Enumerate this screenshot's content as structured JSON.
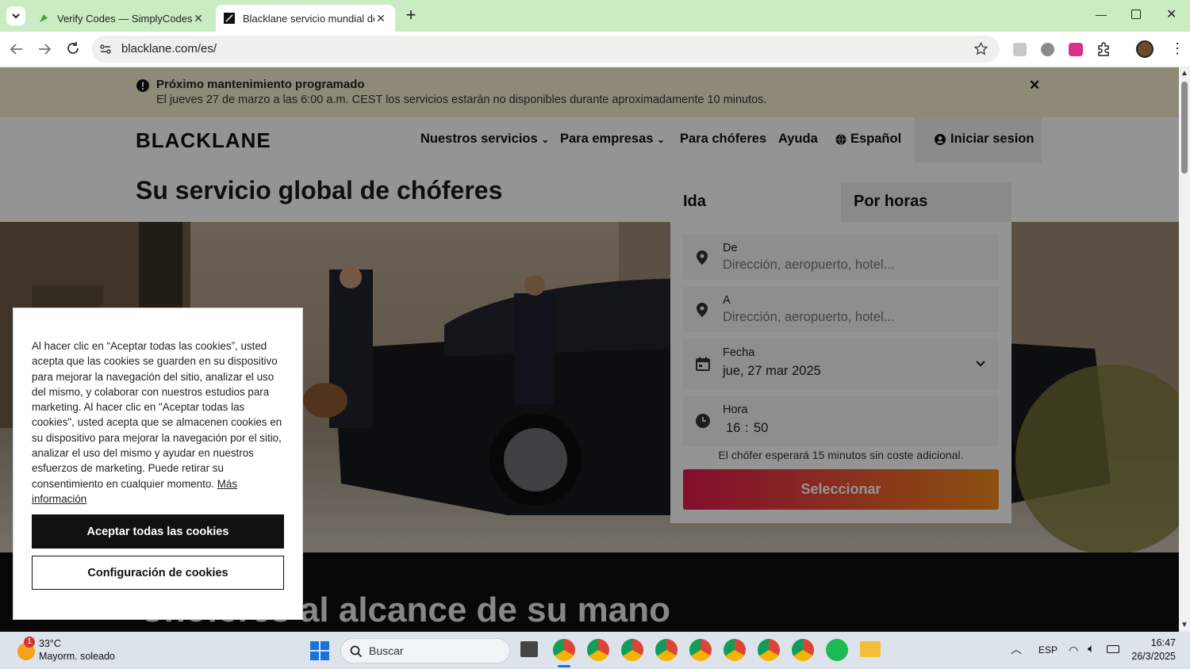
{
  "browser": {
    "tabs": [
      {
        "title": "Verify Codes — SimplyCodes",
        "active": false
      },
      {
        "title": "Blacklane servicio mundial de ch",
        "active": true
      }
    ],
    "url": "blacklane.com/es/"
  },
  "maintenance": {
    "title": "Próximo mantenimiento programado",
    "message": "El jueves 27 de marzo a las 6:00 a.m. CEST los servicios estarán no disponibles durante aproximadamente 10 minutos."
  },
  "nav": {
    "logo": "BLACKLANE",
    "services": "Nuestros servicios",
    "business": "Para empresas",
    "drivers": "Para chóferes",
    "help": "Ayuda",
    "language": "Español",
    "login": "Iniciar sesion"
  },
  "hero": {
    "title": "Su servicio global de chóferes",
    "subheading": "Chóferes al alcance de su mano"
  },
  "booking": {
    "tab_oneway": "Ida",
    "tab_hourly": "Por horas",
    "from_label": "De",
    "from_placeholder": "Dirección, aeropuerto, hotel...",
    "to_label": "A",
    "to_placeholder": "Dirección, aeropuerto, hotel...",
    "date_label": "Fecha",
    "date_value": "jue, 27 mar 2025",
    "time_label": "Hora",
    "time_hour": "16",
    "time_sep": ":",
    "time_minute": "50",
    "wait_note": "El chófer esperará 15 minutos sin coste adicional.",
    "submit": "Seleccionar"
  },
  "cookie": {
    "text": "Al hacer clic en “Aceptar todas las cookies”, usted acepta que las cookies se guarden en su dispositivo para mejorar la navegación del sitio, analizar el uso del mismo, y colaborar con nuestros estudios para marketing. Al hacer clic en \"Aceptar todas las cookies\", usted acepta que se almacenen cookies en su dispositivo para mejorar la navegación por el sitio, analizar el uso del mismo y ayudar en nuestros esfuerzos de marketing. Puede retirar su consentimiento en cualquier momento.",
    "more_link": "Más información",
    "accept": "Aceptar todas las cookies",
    "settings": "Configuración de cookies"
  },
  "taskbar": {
    "weather_temp": "33°C",
    "weather_desc": "Mayorm. soleado",
    "weather_badge": "1",
    "search": "Buscar",
    "lang": "ESP",
    "time": "16:47",
    "date": "26/3/2025"
  },
  "colors": {
    "tabstrip": "#c9ecc3",
    "maintenance_bg": "#f7edce",
    "submit_start": "#e2184f",
    "submit_end": "#f28a1a"
  }
}
